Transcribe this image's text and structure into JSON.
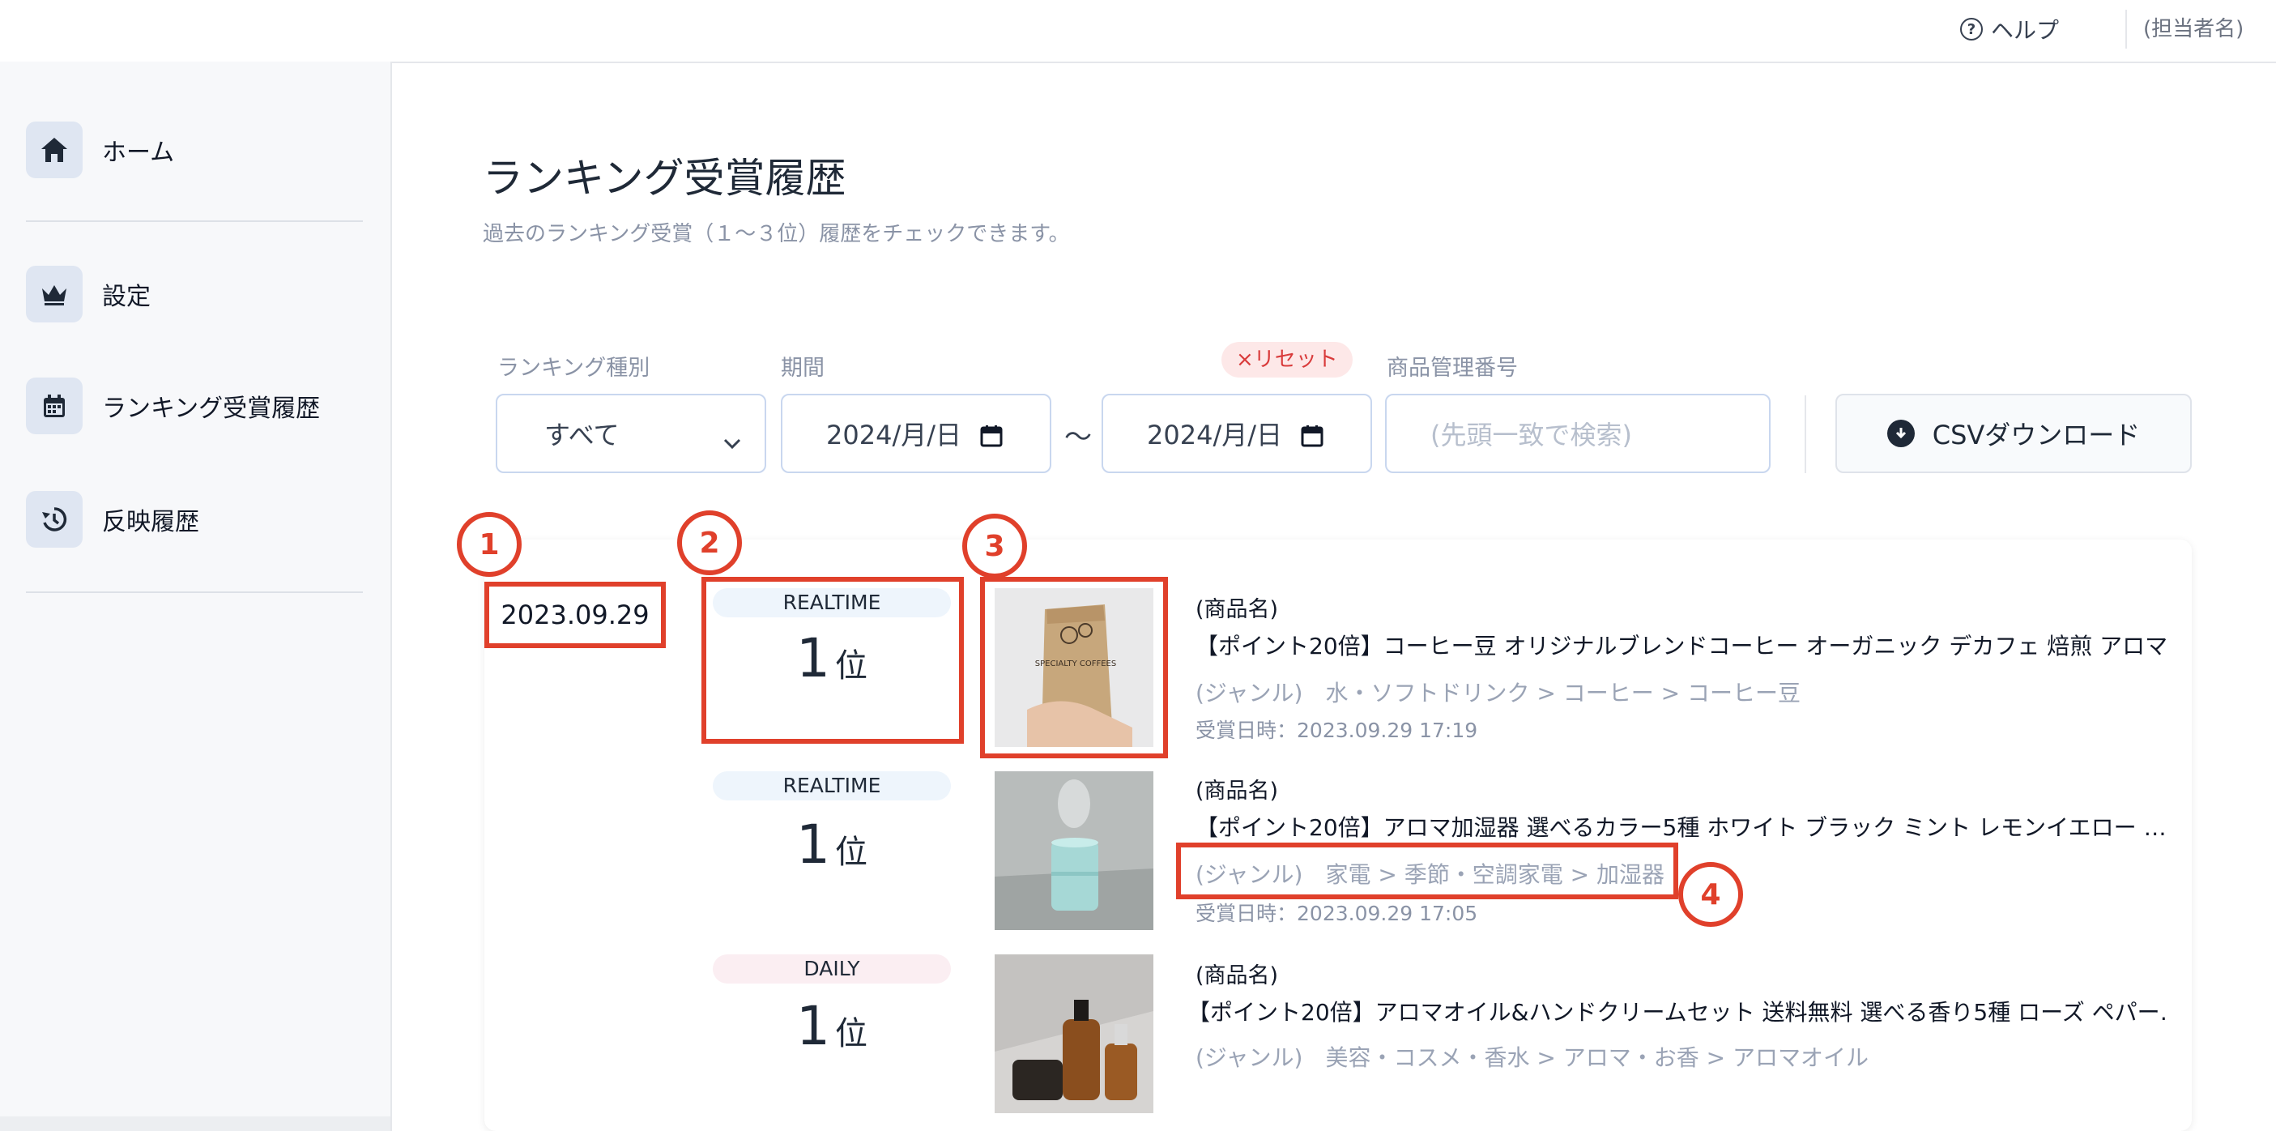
{
  "header": {
    "help_label": "ヘルプ",
    "user_label": "(担当者名)"
  },
  "sidebar": {
    "items": [
      {
        "label": "ホーム",
        "icon": "home-icon"
      },
      {
        "label": "設定",
        "icon": "crown-icon"
      },
      {
        "label": "ランキング受賞履歴",
        "icon": "calendar-icon"
      },
      {
        "label": "反映履歴",
        "icon": "history-icon"
      }
    ]
  },
  "page": {
    "title": "ランキング受賞履歴",
    "subtitle": "過去のランキング受賞（１〜３位）履歴をチェックできます。"
  },
  "filters": {
    "type_label": "ランキング種別",
    "type_value": "すべて",
    "period_label": "期間",
    "date_from": "2024/月/日",
    "date_to": "2024/月/日",
    "tilde": "〜",
    "reset_label": "×リセット",
    "code_label": "商品管理番号",
    "code_placeholder": "(先頭一致で検索)",
    "csv_label": "CSVダウンロード"
  },
  "list": {
    "date": "2023.09.29",
    "rank_unit": "位",
    "product_label": "(商品名)",
    "genre_label": "(ジャンル)",
    "awarded_prefix": "受賞日時：",
    "rows": [
      {
        "badge": "REALTIME",
        "rank": "1",
        "title": "【ポイント20倍】コーヒー豆 オリジナルブレンドコーヒー オーガニック デカフェ 焙煎 アロマ…",
        "genre": "水・ソフトドリンク > コーヒー > コーヒー豆",
        "awarded": "2023.09.29 17:19"
      },
      {
        "badge": "REALTIME",
        "rank": "1",
        "title": "【ポイント20倍】アロマ加湿器 選べるカラー5種 ホワイト ブラック ミント レモンイエロー …",
        "genre": "家電 > 季節・空調家電 > 加湿器",
        "awarded": "2023.09.29 17:05"
      },
      {
        "badge": "DAILY",
        "rank": "1",
        "title": "【ポイント20倍】アロマオイル&ハンドクリームセット 送料無料 選べる香り5種 ローズ ペパー…",
        "genre": "美容・コスメ・香水 > アロマ・お香 > アロマオイル"
      }
    ]
  },
  "annotations": [
    "1",
    "2",
    "3",
    "4"
  ],
  "thumb_text": "SPECIALTY COFFEES",
  "colors": {
    "accent": "#e0402b",
    "muted": "#8a93a6",
    "badge_realtime": "#eef5fc",
    "badge_daily": "#fbeef2"
  }
}
